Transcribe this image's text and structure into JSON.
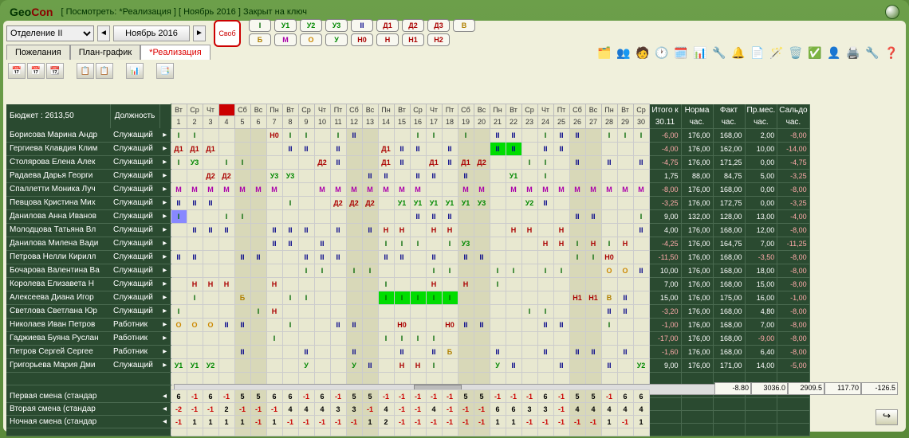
{
  "brand_prefix": "Geo",
  "brand_suffix": "Con",
  "title": "[ Посмотреть: *Реализация ] [ Ноябрь 2016 ] Закрыт на ключ",
  "department": "Отделение II",
  "month": "Ноябрь 2016",
  "tabs": {
    "wishes": "Пожелания",
    "plan": "План-график",
    "real": "*Реализация"
  },
  "svob": "Своб",
  "shift_row1": [
    "I",
    "У1",
    "У2",
    "У3",
    "II",
    "Д1",
    "Д2",
    "Д3",
    "В"
  ],
  "shift_row2": [
    "Б",
    "М",
    "О",
    "У",
    "Н0",
    "Н",
    "Н1",
    "Н2"
  ],
  "budget_label": "Бюджет : 2613,50",
  "position_label": "Должность",
  "weekdays": [
    "Вт",
    "Ср",
    "Чт",
    "",
    "Сб",
    "Вс",
    "Пн",
    "Вт",
    "Ср",
    "Чт",
    "Пт",
    "Сб",
    "Вс",
    "Пн",
    "Вт",
    "Ср",
    "Чт",
    "Пт",
    "Сб",
    "Вс",
    "Пн",
    "Вт",
    "Ср",
    "Чт",
    "Пт",
    "Сб",
    "Вс",
    "Пн",
    "Вт",
    "Ср"
  ],
  "days": [
    "1",
    "2",
    "3",
    "4",
    "5",
    "6",
    "7",
    "8",
    "9",
    "10",
    "11",
    "12",
    "13",
    "14",
    "15",
    "16",
    "17",
    "18",
    "19",
    "20",
    "21",
    "22",
    "23",
    "24",
    "25",
    "26",
    "27",
    "28",
    "29",
    "30"
  ],
  "weekend_idx": [
    4,
    5,
    11,
    12,
    18,
    19,
    25,
    26
  ],
  "totals_header": {
    "itogo": "Итого к",
    "date": "30.11",
    "norma": "Норма",
    "norma_u": "час.",
    "fakt": "Факт",
    "fakt_u": "час.",
    "prmes": "Пр.мес.",
    "prmes_u": "час.",
    "saldo": "Сальдо",
    "saldo_u": "час."
  },
  "rows": [
    {
      "name": "Борисова Марина Андр",
      "pos": "Служащий",
      "c": [
        "I",
        "I",
        "",
        "",
        "",
        "",
        "Н0",
        "I",
        "I",
        "",
        "I",
        "II",
        "",
        "",
        "",
        "I",
        "I",
        "",
        "I",
        "",
        "II",
        "II",
        "",
        "I",
        "II",
        "II",
        "",
        "I",
        "I",
        "I"
      ],
      "t": [
        "-6,00",
        "176,00",
        "168,00",
        "2,00",
        "-8,00"
      ]
    },
    {
      "name": "Гергиева Клавдия Клим",
      "pos": "Служащий",
      "c": [
        "Д1",
        "Д1",
        "Д1",
        "",
        "",
        "",
        "",
        "II",
        "II",
        "",
        "II",
        "",
        "",
        "Д1",
        "II",
        "II",
        "",
        "II",
        "",
        "",
        "II",
        "II",
        "",
        "II",
        "II",
        "",
        "",
        "",
        "",
        ""
      ],
      "bg": {
        "20": "green",
        "21": "green"
      },
      "t": [
        "-4,00",
        "176,00",
        "162,00",
        "10,00",
        "-14,00"
      ]
    },
    {
      "name": "Столярова Елена Алек",
      "pos": "Служащий",
      "c": [
        "I",
        "У3",
        "",
        "I",
        "I",
        "",
        "",
        "",
        "",
        "Д2",
        "II",
        "",
        "",
        "Д1",
        "II",
        "",
        "Д1",
        "II",
        "Д1",
        "Д2",
        "",
        "",
        "I",
        "I",
        "",
        "II",
        "",
        "II",
        "",
        "II"
      ],
      "t": [
        "-4,75",
        "176,00",
        "171,25",
        "0,00",
        "-4,75"
      ]
    },
    {
      "name": "Радаева Дарья Георги",
      "pos": "Служащий",
      "c": [
        "",
        "",
        "Д2",
        "Д2",
        "",
        "",
        "У3",
        "У3",
        "",
        "",
        "",
        "",
        "II",
        "II",
        "",
        "II",
        "II",
        "",
        "II",
        "",
        "",
        "У1",
        "",
        "I",
        "",
        "",
        "",
        "",
        "",
        ""
      ],
      "t": [
        "1,75",
        "88,00",
        "84,75",
        "5,00",
        "-3,25"
      ]
    },
    {
      "name": "Спаллетти Моника Луч",
      "pos": "Служащий",
      "c": [
        "М",
        "М",
        "М",
        "М",
        "М",
        "М",
        "М",
        "",
        "",
        "М",
        "М",
        "М",
        "М",
        "М",
        "М",
        "М",
        "",
        "",
        "М",
        "М",
        "",
        "М",
        "М",
        "М",
        "М",
        "М",
        "М",
        "М",
        "М",
        "М"
      ],
      "t": [
        "-8,00",
        "176,00",
        "168,00",
        "0,00",
        "-8,00"
      ]
    },
    {
      "name": "Певцова Кристина Мих",
      "pos": "Служащий",
      "c": [
        "II",
        "II",
        "II",
        "",
        "",
        "",
        "",
        "I",
        "",
        "",
        "Д2",
        "Д2",
        "Д2",
        "",
        "У1",
        "У1",
        "У1",
        "У1",
        "У1",
        "У3",
        "",
        "",
        "У2",
        "II",
        "",
        "",
        "",
        "",
        "",
        ""
      ],
      "t": [
        "-3,25",
        "176,00",
        "172,75",
        "0,00",
        "-3,25"
      ]
    },
    {
      "name": "Данилова Анна Иванов",
      "pos": "Служащий",
      "c": [
        "I",
        "",
        "",
        "I",
        "I",
        "",
        "",
        "",
        "",
        "",
        "",
        "",
        "",
        "",
        "",
        "II",
        "II",
        "II",
        "",
        "",
        "",
        "",
        "",
        "",
        "",
        "II",
        "II",
        "",
        "",
        "I"
      ],
      "bg": {
        "0": "blue"
      },
      "t": [
        "9,00",
        "132,00",
        "128,00",
        "13,00",
        "-4,00"
      ]
    },
    {
      "name": "Молодцова Татьяна Вл",
      "pos": "Служащий",
      "c": [
        "",
        "II",
        "II",
        "II",
        "",
        "",
        "II",
        "II",
        "II",
        "",
        "II",
        "",
        "II",
        "Н",
        "Н",
        "",
        "Н",
        "Н",
        "",
        "",
        "",
        "Н",
        "Н",
        "",
        "Н",
        "",
        "",
        "",
        "",
        "II"
      ],
      "t": [
        "4,00",
        "176,00",
        "168,00",
        "12,00",
        "-8,00"
      ]
    },
    {
      "name": "Данилова Милена Вади",
      "pos": "Служащий",
      "c": [
        "",
        "",
        "",
        "",
        "",
        "",
        "II",
        "II",
        "",
        "II",
        "",
        "",
        "",
        "I",
        "I",
        "I",
        "",
        "I",
        "У3",
        "",
        "",
        "",
        "",
        "Н",
        "Н",
        "I",
        "Н",
        "I",
        "Н",
        ""
      ],
      "t": [
        "-4,25",
        "176,00",
        "164,75",
        "7,00",
        "-11,25"
      ]
    },
    {
      "name": "Петрова Нелли Кирилл",
      "pos": "Служащий",
      "c": [
        "II",
        "II",
        "",
        "",
        "II",
        "II",
        "",
        "",
        "II",
        "II",
        "II",
        "",
        "",
        "II",
        "II",
        "",
        "II",
        "",
        "II",
        "II",
        "",
        "",
        "",
        "",
        "",
        "I",
        "I",
        "Н0",
        "",
        ""
      ],
      "t": [
        "-11,50",
        "176,00",
        "168,00",
        "-3,50",
        "-8,00"
      ]
    },
    {
      "name": "Бочарова Валентина Ва",
      "pos": "Служащий",
      "c": [
        "",
        "",
        "",
        "",
        "",
        "",
        "",
        "",
        "I",
        "I",
        "",
        "I",
        "I",
        "",
        "",
        "",
        "I",
        "I",
        "",
        "",
        "I",
        "I",
        "",
        "I",
        "I",
        "",
        "",
        "О",
        "О",
        "II"
      ],
      "t": [
        "10,00",
        "176,00",
        "168,00",
        "18,00",
        "-8,00"
      ]
    },
    {
      "name": "Королева Елизавета Н",
      "pos": "Служащий",
      "c": [
        "",
        "Н",
        "Н",
        "Н",
        "",
        "",
        "Н",
        "",
        "",
        "",
        "",
        "",
        "",
        "I",
        "",
        "",
        "Н",
        "",
        "Н",
        "",
        "I",
        "",
        "",
        "",
        "",
        "",
        "",
        "",
        "",
        ""
      ],
      "t": [
        "7,00",
        "176,00",
        "168,00",
        "15,00",
        "-8,00"
      ]
    },
    {
      "name": "Алексеева Диана Игор",
      "pos": "Служащий",
      "c": [
        "",
        "I",
        "",
        "",
        "Б",
        "",
        "",
        "I",
        "I",
        "",
        "",
        "",
        "",
        "I",
        "I",
        "I",
        "I",
        "I",
        "",
        "",
        "",
        "",
        "",
        "",
        "",
        "Н1",
        "Н1",
        "В",
        "II",
        ""
      ],
      "bg": {
        "13": "green",
        "14": "green",
        "15": "green",
        "16": "green",
        "17": "green"
      },
      "t": [
        "15,00",
        "176,00",
        "175,00",
        "16,00",
        "-1,00"
      ]
    },
    {
      "name": "Светлова Светлана Юр",
      "pos": "Служащий",
      "c": [
        "I",
        "",
        "",
        "",
        "",
        "I",
        "Н",
        "",
        "",
        "",
        "",
        "",
        "",
        "",
        "",
        "",
        "",
        "",
        "",
        "",
        "",
        "",
        "I",
        "I",
        "",
        "",
        "",
        "II",
        "II",
        ""
      ],
      "t": [
        "-3,20",
        "176,00",
        "168,00",
        "4,80",
        "-8,00"
      ]
    },
    {
      "name": "Николаев Иван Петров",
      "pos": "Работник",
      "c": [
        "О",
        "О",
        "О",
        "II",
        "II",
        "",
        "",
        "I",
        "",
        "",
        "II",
        "II",
        "",
        "",
        "Н0",
        "",
        "",
        "Н0",
        "II",
        "II",
        "",
        "",
        "",
        "II",
        "II",
        "",
        "",
        "I",
        "",
        ""
      ],
      "t": [
        "-1,00",
        "176,00",
        "168,00",
        "7,00",
        "-8,00"
      ]
    },
    {
      "name": "Гаджиева Буяна Руслан",
      "pos": "Работник",
      "c": [
        "",
        "",
        "",
        "",
        "",
        "",
        "I",
        "",
        "",
        "",
        "",
        "",
        "",
        "I",
        "I",
        "I",
        "I",
        "",
        "",
        "",
        "",
        "",
        "",
        "",
        "",
        "",
        "",
        "",
        "",
        ""
      ],
      "t": [
        "-17,00",
        "176,00",
        "168,00",
        "-9,00",
        "-8,00"
      ]
    },
    {
      "name": "Петров Сергей Сергее",
      "pos": "Работник",
      "c": [
        "",
        "",
        "",
        "",
        "II",
        "",
        "",
        "",
        "II",
        "",
        "",
        "II",
        "",
        "",
        "II",
        "",
        "II",
        "Б",
        "",
        "",
        "II",
        "",
        "",
        "II",
        "",
        "II",
        "II",
        "",
        "II",
        ""
      ],
      "t": [
        "-1,60",
        "176,00",
        "168,00",
        "6,40",
        "-8,00"
      ]
    },
    {
      "name": "Григорьева Мария Дми",
      "pos": "Служащий",
      "c": [
        "У1",
        "У1",
        "У2",
        "",
        "",
        "",
        "",
        "",
        "У",
        "",
        "",
        "У",
        "II",
        "",
        "Н",
        "Н",
        "I",
        "",
        "",
        "",
        "У",
        "II",
        "",
        "",
        "II",
        "",
        "",
        "II",
        "",
        "У2"
      ],
      "t": [
        "9,00",
        "176,00",
        "171,00",
        "14,00",
        "-5,00"
      ]
    }
  ],
  "empty_rows": 5,
  "summary_rows": [
    {
      "label": "Первая смена (стандар",
      "c": [
        "6",
        "-1",
        "6",
        "-1",
        "5",
        "5",
        "6",
        "6",
        "-1",
        "6",
        "-1",
        "5",
        "5",
        "-1",
        "-1",
        "-1",
        "-1",
        "-1",
        "5",
        "5",
        "-1",
        "-1",
        "-1",
        "6",
        "-1",
        "5",
        "5",
        "-1",
        "6",
        "6"
      ]
    },
    {
      "label": "Вторая смена (стандар",
      "c": [
        "-2",
        "-1",
        "-1",
        "2",
        "-1",
        "-1",
        "-1",
        "4",
        "4",
        "4",
        "3",
        "3",
        "-1",
        "4",
        "-1",
        "-1",
        "4",
        "-1",
        "-1",
        "-1",
        "6",
        "6",
        "3",
        "3",
        "-1",
        "4",
        "4",
        "4",
        "4",
        "4"
      ]
    },
    {
      "label": "Ночная смена (стандар",
      "c": [
        "-1",
        "1",
        "1",
        "1",
        "1",
        "-1",
        "1",
        "-1",
        "-1",
        "-1",
        "-1",
        "-1",
        "1",
        "2",
        "-1",
        "-1",
        "-1",
        "-1",
        "-1",
        "-1",
        "1",
        "1",
        "-1",
        "-1",
        "-1",
        "-1",
        "-1",
        "1",
        "-1",
        "1"
      ]
    }
  ],
  "status": [
    "-8.80",
    "3036.0",
    "2909.5",
    "117.70",
    "-126.5"
  ]
}
